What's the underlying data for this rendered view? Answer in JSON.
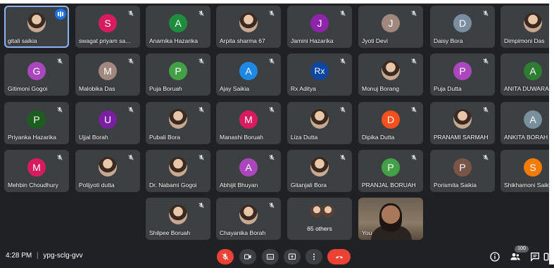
{
  "meeting": {
    "time": "4:28 PM",
    "separator": "|",
    "code": "ypg-sclg-gvv",
    "participant_count": "100"
  },
  "colors": {
    "background": "#202124",
    "tile": "#3c4043",
    "end_call": "#ea4335",
    "mic_off": "#ea4335"
  },
  "participants": [
    {
      "name": "gitali saikia",
      "type": "photo",
      "speaking": true
    },
    {
      "name": "swagat priyam sa...",
      "initial": "S",
      "color": "#d81b60"
    },
    {
      "name": "Anamika Hazarika",
      "initial": "A",
      "color": "#1e8e3e"
    },
    {
      "name": "Arpita sharma 67",
      "type": "photo"
    },
    {
      "name": "Jamini Hazarika",
      "initial": "J",
      "color": "#8e24aa"
    },
    {
      "name": "Jyoti Devi",
      "initial": "J",
      "color": "#a1887f"
    },
    {
      "name": "Daisy Bora",
      "initial": "D",
      "color": "#7a8ea0"
    },
    {
      "name": "Dimpimoni Das",
      "type": "photo"
    },
    {
      "name": "Gitimoni Gogoi",
      "initial": "G",
      "color": "#ab47bc"
    },
    {
      "name": "Malobika Das",
      "initial": "M",
      "color": "#a1887f"
    },
    {
      "name": "Puja Boruah",
      "initial": "P",
      "color": "#43a047"
    },
    {
      "name": "Ajay Saikia",
      "initial": "A",
      "color": "#1e88e5"
    },
    {
      "name": "Rx Aditya",
      "initial": "Rx",
      "color": "#0d47a1"
    },
    {
      "name": "Monuj Borang",
      "type": "photo"
    },
    {
      "name": "Puja Dutta",
      "initial": "P",
      "color": "#ab47bc"
    },
    {
      "name": "ANITA DUWARAH",
      "initial": "A",
      "color": "#2e7d32"
    },
    {
      "name": "Priyanka Hazarika",
      "initial": "P",
      "color": "#1b5e20"
    },
    {
      "name": "Ujjal Borah",
      "initial": "U",
      "color": "#7b1fa2"
    },
    {
      "name": "Pubali Bora",
      "type": "photo"
    },
    {
      "name": "Manashi Boruah",
      "initial": "M",
      "color": "#d81b60"
    },
    {
      "name": "Liza Dutta",
      "type": "photo"
    },
    {
      "name": "Dipika Dutta",
      "initial": "D",
      "color": "#f4511e"
    },
    {
      "name": "PRANAMI SARMAH",
      "type": "photo"
    },
    {
      "name": "ANKITA BORAH",
      "initial": "A",
      "color": "#78909c"
    },
    {
      "name": "Mehbin Choudhury",
      "initial": "M",
      "color": "#d81b60"
    },
    {
      "name": "Polijyoti dutta",
      "type": "photo"
    },
    {
      "name": "Dr. Nabami Gogoi",
      "type": "photo"
    },
    {
      "name": "Abhijit Bhuyan",
      "initial": "A",
      "color": "#ab47bc"
    },
    {
      "name": "Gitanjali Bora",
      "type": "photo"
    },
    {
      "name": "PRANJAL BORUAH",
      "initial": "P",
      "color": "#43a047"
    },
    {
      "name": "Porismita Saikia",
      "initial": "P",
      "color": "#795548"
    },
    {
      "name": "Shikhamoni Saikia",
      "initial": "S",
      "color": "#f57c00"
    },
    {
      "name": "Shilpee Boruah",
      "type": "photo"
    },
    {
      "name": "Chayanika Borah",
      "type": "photo"
    },
    {
      "name": "65 others",
      "type": "others"
    },
    {
      "name": "You",
      "type": "self"
    }
  ],
  "controls": [
    {
      "name": "mic-off-button",
      "icon": "mic-off-icon",
      "color": "#ea4335"
    },
    {
      "name": "camera-button",
      "icon": "camera-icon"
    },
    {
      "name": "captions-button",
      "icon": "captions-icon"
    },
    {
      "name": "present-button",
      "icon": "present-icon"
    },
    {
      "name": "more-options-button",
      "icon": "more-vert-icon"
    },
    {
      "name": "end-call-button",
      "icon": "call-end-icon",
      "color": "#ea4335"
    }
  ],
  "right_controls": [
    "info-icon",
    "people-icon",
    "chat-icon",
    "activities-icon"
  ]
}
